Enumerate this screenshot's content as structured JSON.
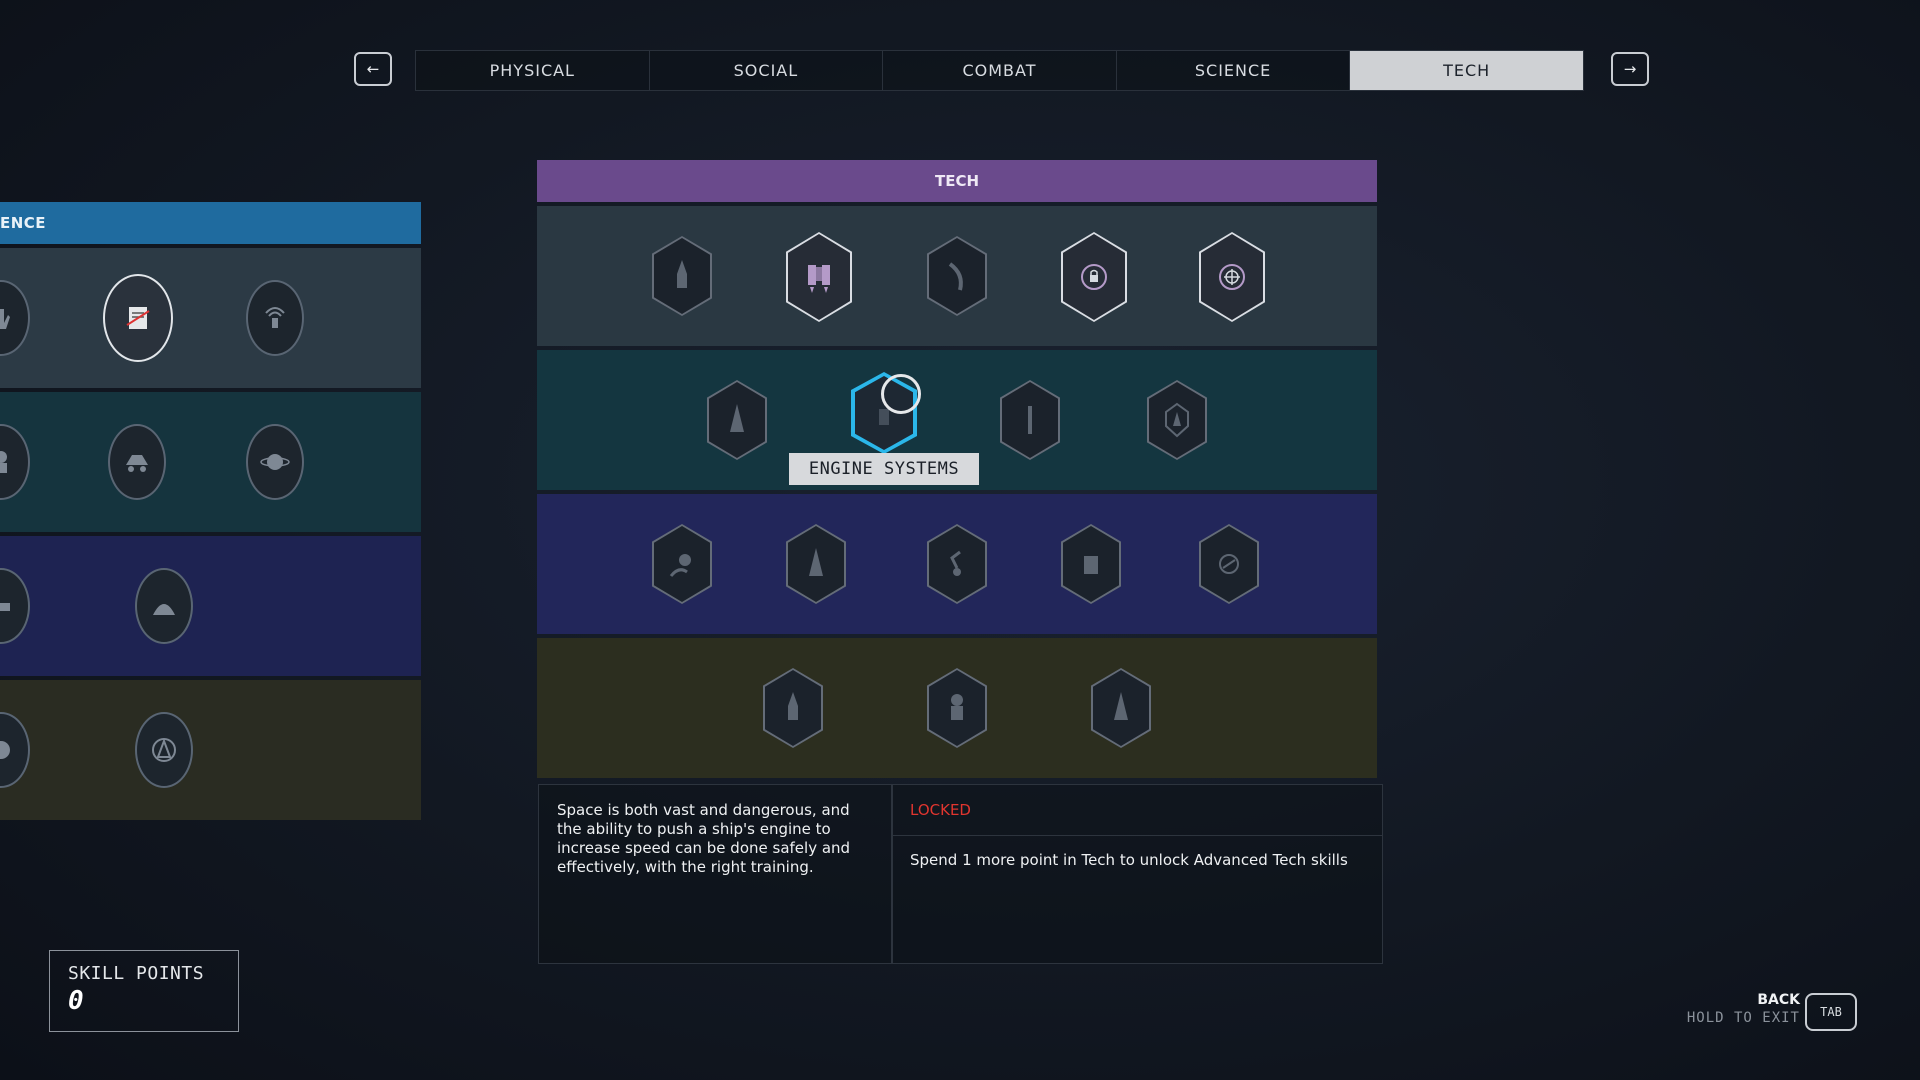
{
  "tabs": [
    {
      "label": "PHYSICAL",
      "active": false
    },
    {
      "label": "SOCIAL",
      "active": false
    },
    {
      "label": "COMBAT",
      "active": false
    },
    {
      "label": "SCIENCE",
      "active": false
    },
    {
      "label": "TECH",
      "active": true
    }
  ],
  "nav": {
    "prev_icon": "←",
    "next_icon": "→"
  },
  "left_panel": {
    "header": "ENCE"
  },
  "tech_panel": {
    "header": "TECH",
    "selected_skill": "ENGINE SYSTEMS",
    "header_color": "#6a4a8c"
  },
  "description": {
    "text": "Space is both vast and dangerous, and the ability to push a ship's engine to increase speed can be done safely and effectively, with the right training."
  },
  "lock": {
    "status": "LOCKED",
    "message": "Spend 1 more point in Tech to unlock Advanced Tech skills",
    "status_color": "#e0352f"
  },
  "skill_points": {
    "label": "SKILL POINTS",
    "value": "0"
  },
  "back": {
    "label": "BACK",
    "hold": "HOLD TO EXIT",
    "key": "TAB"
  },
  "icons": [
    "rocket-icon",
    "jetpack-icon",
    "comet-icon",
    "lock-target-icon",
    "crosshair-icon",
    "ship-icon",
    "engine-icon",
    "missile-icon",
    "drone-icon",
    "planet-icon",
    "astronaut-icon",
    "robot-arm-icon",
    "gear-icon"
  ]
}
